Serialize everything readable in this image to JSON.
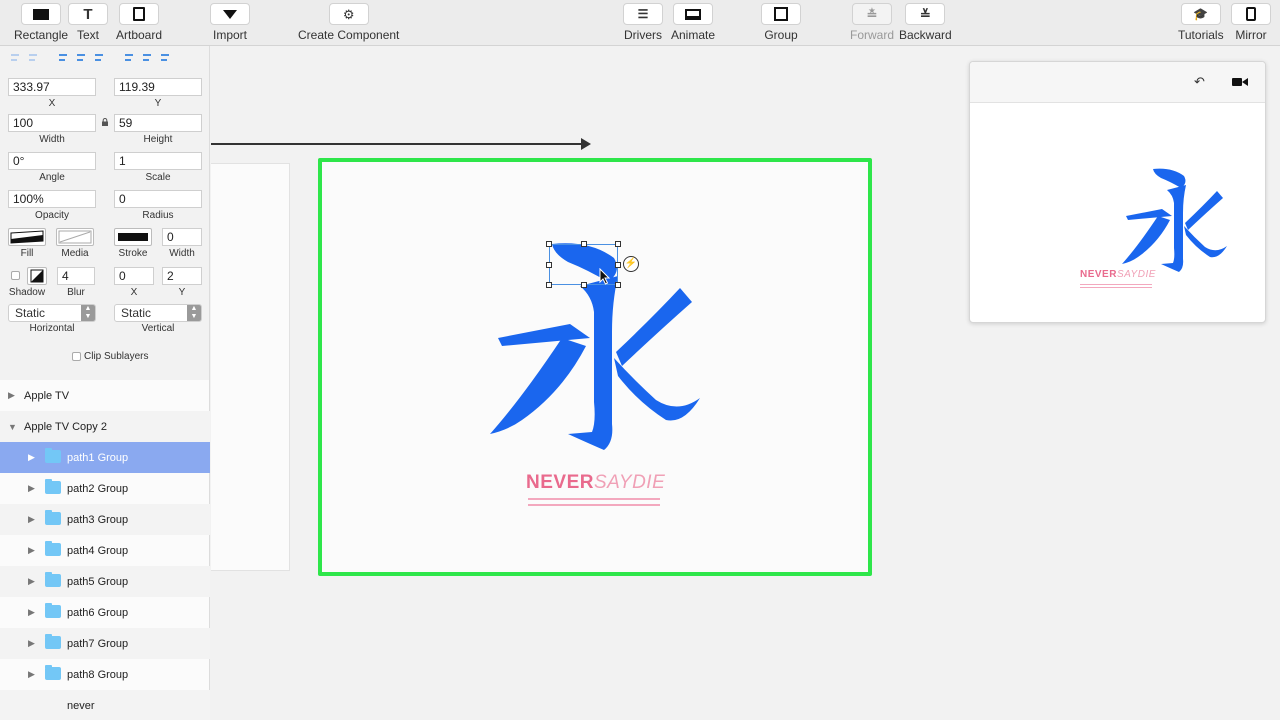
{
  "toolbar": {
    "rectangle": "Rectangle",
    "text": "Text",
    "artboard": "Artboard",
    "import": "Import",
    "create_component": "Create Component",
    "drivers": "Drivers",
    "animate": "Animate",
    "group": "Group",
    "forward": "Forward",
    "backward": "Backward",
    "tutorials": "Tutorials",
    "mirror": "Mirror"
  },
  "inspector": {
    "x": "333.97",
    "x_label": "X",
    "y": "119.39",
    "y_label": "Y",
    "width": "100",
    "width_label": "Width",
    "height": "59",
    "height_label": "Height",
    "angle": "0°",
    "angle_label": "Angle",
    "scale": "1",
    "scale_label": "Scale",
    "opacity": "100%",
    "opacity_label": "Opacity",
    "radius": "0",
    "radius_label": "Radius",
    "fill_label": "Fill",
    "media_label": "Media",
    "stroke_label": "Stroke",
    "stroke_width": "0",
    "stroke_width_label": "Width",
    "shadow_label": "Shadow",
    "blur": "4",
    "blur_label": "Blur",
    "shadow_x": "0",
    "shadow_x_label": "X",
    "shadow_y": "2",
    "shadow_y_label": "Y",
    "horizontal": "Static",
    "horizontal_label": "Horizontal",
    "vertical": "Static",
    "vertical_label": "Vertical",
    "clip_sublayers": "Clip Sublayers"
  },
  "layers": [
    {
      "name": "Apple TV",
      "expanded": false
    },
    {
      "name": "Apple TV Copy 2",
      "expanded": true
    },
    {
      "name": "path1 Group",
      "selected": true
    },
    {
      "name": "path2 Group"
    },
    {
      "name": "path3 Group"
    },
    {
      "name": "path4 Group"
    },
    {
      "name": "path5 Group"
    },
    {
      "name": "path6 Group"
    },
    {
      "name": "path7 Group"
    },
    {
      "name": "path8 Group"
    },
    {
      "name": "never"
    }
  ],
  "artwork": {
    "brand_bold": "NEVER",
    "brand_light": "SAYDIE"
  },
  "colors": {
    "glyph": "#1a66ee",
    "artboard_border": "#2ee64a",
    "brand": "#e96a8d",
    "selected_layer": "#8aa9f0"
  }
}
